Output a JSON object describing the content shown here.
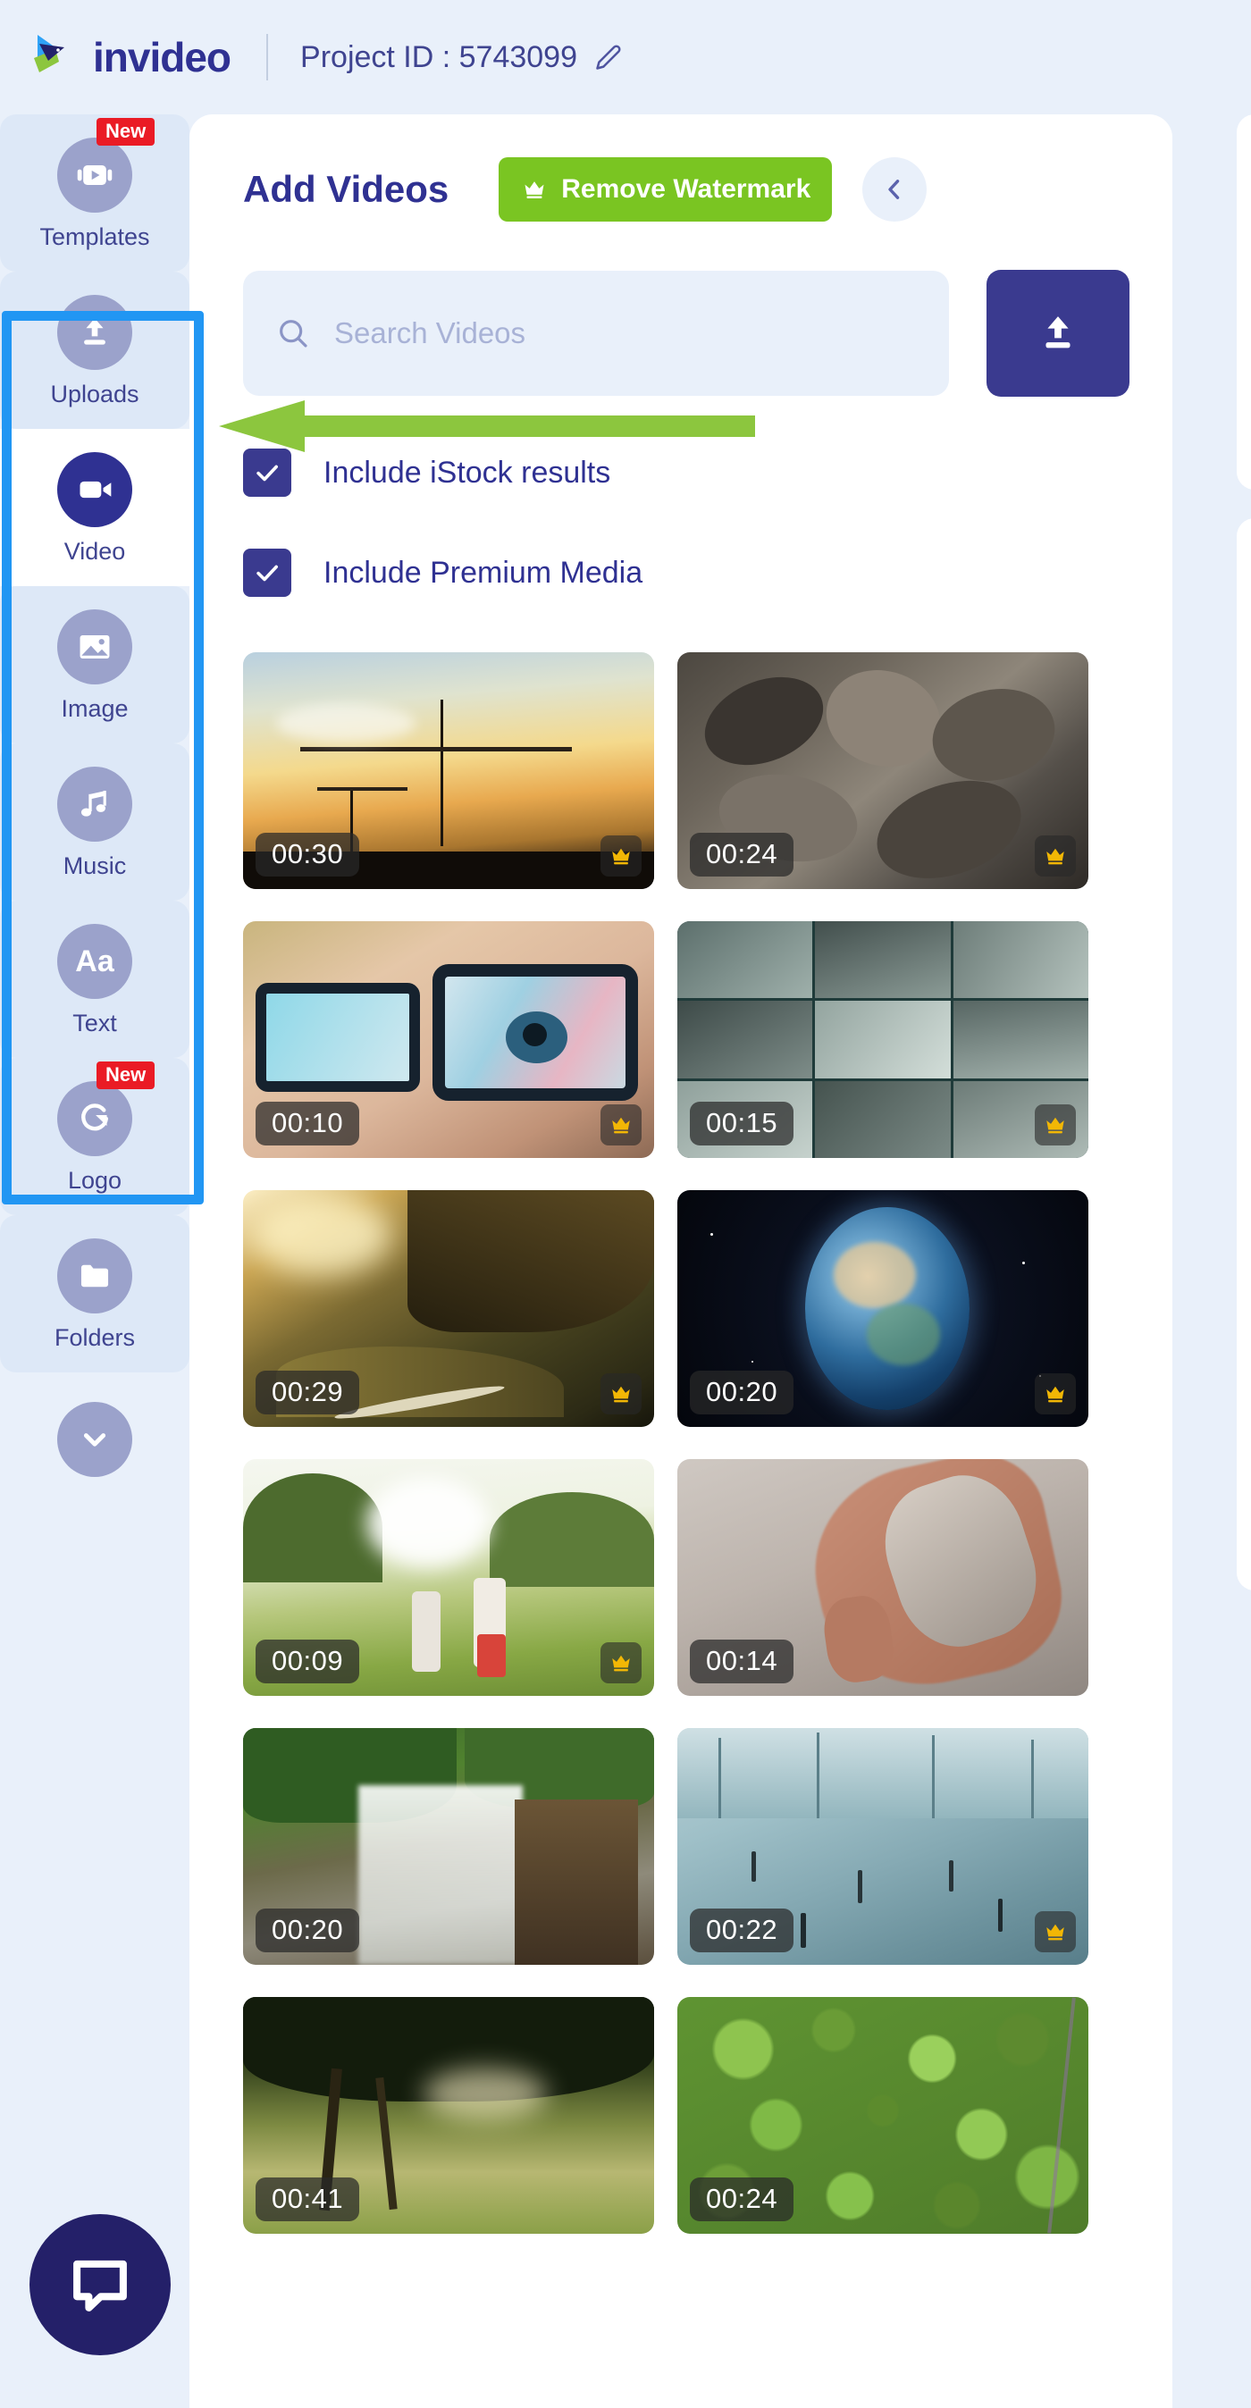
{
  "header": {
    "brand": "invideo",
    "brand_icon": "invideo-logo-icon",
    "project_label": "Project ID : 5743099",
    "edit_icon": "pencil-icon"
  },
  "sidebar": {
    "items": [
      {
        "label": "Templates",
        "icon": "video-template-icon",
        "badge": "New",
        "state": "default"
      },
      {
        "label": "Uploads",
        "icon": "upload-icon",
        "badge": "",
        "state": "selected"
      },
      {
        "label": "Video",
        "icon": "video-camera-icon",
        "badge": "",
        "state": "active"
      },
      {
        "label": "Image",
        "icon": "image-icon",
        "badge": "",
        "state": "default"
      },
      {
        "label": "Music",
        "icon": "music-note-icon",
        "badge": "",
        "state": "default"
      },
      {
        "label": "Text",
        "icon": "text-aa-icon",
        "badge": "",
        "state": "default"
      },
      {
        "label": "Logo",
        "icon": "logo-brand-icon",
        "badge": "New",
        "state": "default"
      },
      {
        "label": "Folders",
        "icon": "folder-icon",
        "badge": "",
        "state": "default"
      }
    ],
    "more_icon": "chevron-down-icon",
    "chat_icon": "chat-bubble-icon"
  },
  "panel": {
    "title": "Add Videos",
    "remove_watermark_label": "Remove Watermark",
    "crown_icon": "crown-icon",
    "collapse_icon": "chevron-left-icon"
  },
  "search": {
    "placeholder": "Search Videos",
    "value": "",
    "search_icon": "search-icon",
    "upload_icon": "upload-icon"
  },
  "filters": [
    {
      "label": "Include iStock results",
      "checked": true,
      "icon": "checkmark-icon"
    },
    {
      "label": "Include Premium Media",
      "checked": true,
      "icon": "checkmark-icon"
    }
  ],
  "videos": [
    {
      "duration": "00:30",
      "premium": true,
      "alt": "construction-cranes-sunset"
    },
    {
      "duration": "00:24",
      "premium": true,
      "alt": "sea-lions-colony"
    },
    {
      "duration": "00:10",
      "premium": true,
      "alt": "eyeglasses-screen-reflection"
    },
    {
      "duration": "00:15",
      "premium": true,
      "alt": "cctv-surveillance-grid"
    },
    {
      "duration": "00:29",
      "premium": true,
      "alt": "aerial-mountain-valley"
    },
    {
      "duration": "00:20",
      "premium": true,
      "alt": "earth-from-space"
    },
    {
      "duration": "00:09",
      "premium": true,
      "alt": "children-running-field"
    },
    {
      "duration": "00:14",
      "premium": false,
      "alt": "hand-with-sand"
    },
    {
      "duration": "00:20",
      "premium": false,
      "alt": "jungle-waterfall"
    },
    {
      "duration": "00:22",
      "premium": true,
      "alt": "airport-terminal"
    },
    {
      "duration": "00:41",
      "premium": false,
      "alt": "tree-golden-light"
    },
    {
      "duration": "00:24",
      "premium": false,
      "alt": "aerial-forest-canopy"
    }
  ],
  "annotations": {
    "arrow_color": "#8cc63e",
    "highlight_color": "#2196f3",
    "arrow_points_to": "Uploads"
  },
  "colors": {
    "brand_blue": "#2f3192",
    "accent_green": "#7ac522",
    "badge_red": "#ea1b25",
    "page_bg": "#e9f0fa",
    "crown_gold": "#f2b705"
  }
}
